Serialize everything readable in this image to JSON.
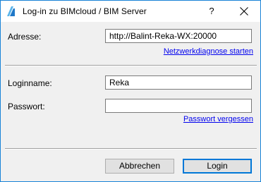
{
  "window": {
    "title": "Log-in zu BIMcloud / BIM Server"
  },
  "titlebar": {
    "help_label": "?"
  },
  "server": {
    "address_label": "Adresse:",
    "address_value": "http://Balint-Reka-WX:20000",
    "diagnose_link": "Netzwerkdiagnose starten"
  },
  "credentials": {
    "login_label": "Loginname:",
    "login_value": "Reka",
    "password_label": "Passwort:",
    "password_value": "",
    "forgot_link": "Passwort vergessen"
  },
  "buttons": {
    "cancel_label": "Abbrechen",
    "login_label": "Login"
  },
  "icons": {
    "app": "bimcloud-icon",
    "help": "help-icon",
    "close": "close-icon"
  },
  "colors": {
    "window_border": "#1883d7",
    "link": "#0000ee",
    "primary_focus": "#0078d7"
  }
}
